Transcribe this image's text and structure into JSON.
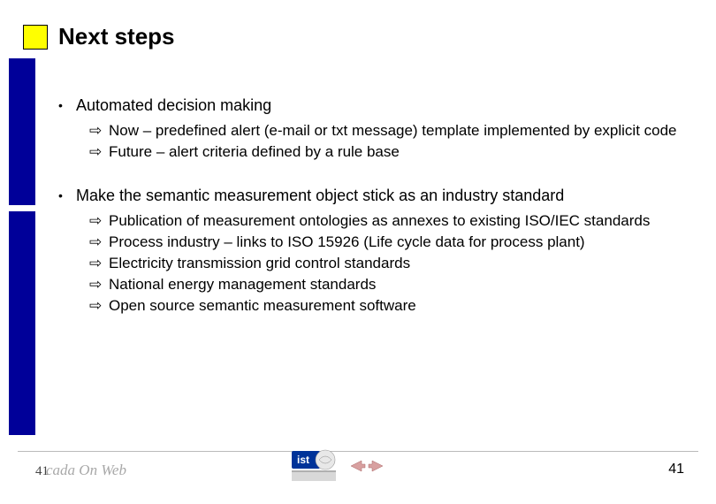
{
  "title": "Next steps",
  "bullets": [
    {
      "text": "Automated decision making",
      "subs": [
        "Now – predefined alert (e-mail or txt message) template implemented by explicit code",
        "Future – alert criteria defined by a rule base"
      ]
    },
    {
      "text": "Make the semantic measurement object stick as an industry standard",
      "subs": [
        "Publication of measurement ontologies as annexes to existing ISO/IEC standards",
        "Process industry – links to ISO 15926 (Life cycle data for process plant)",
        "Electricity transmission grid control standards",
        "National energy management standards",
        "Open source semantic measurement software"
      ]
    }
  ],
  "footer": {
    "page_left": "41",
    "brand": "cada On Web",
    "page_right": "41",
    "logo_text": "ist"
  }
}
